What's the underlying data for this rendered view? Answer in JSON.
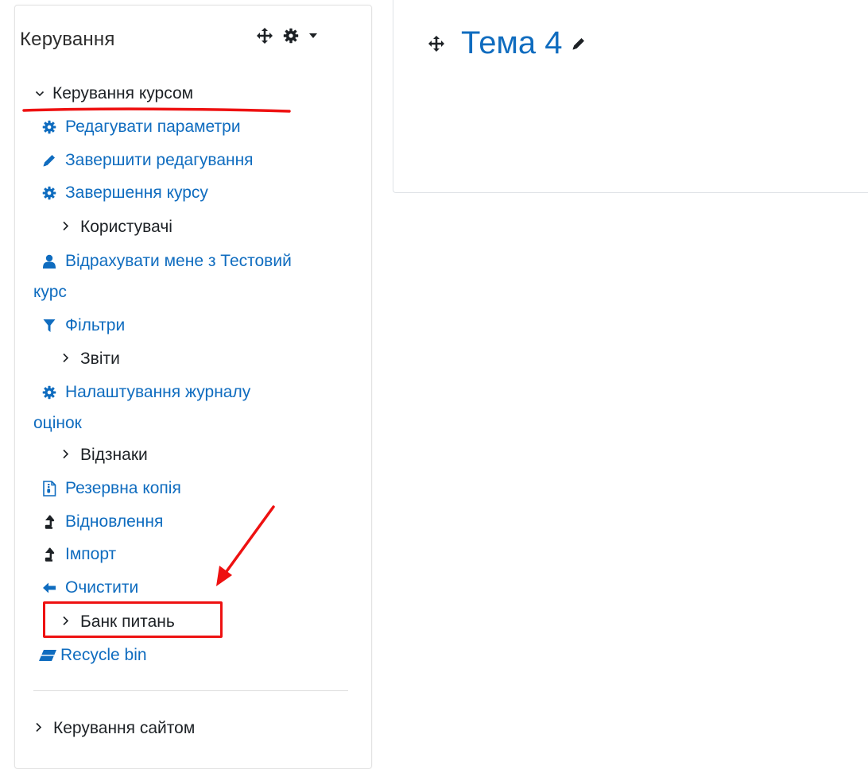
{
  "block": {
    "title": "Керування",
    "course_admin": {
      "label": "Керування курсом",
      "items": [
        {
          "id": "edit-settings",
          "label": "Редагувати параметри",
          "icon": "gear-icon",
          "kind": "link"
        },
        {
          "id": "turn-editing-off",
          "label": "Завершити редагування",
          "icon": "pencil-icon",
          "kind": "link"
        },
        {
          "id": "course-completion",
          "label": "Завершення курсу",
          "icon": "gear-icon",
          "kind": "link"
        },
        {
          "id": "users",
          "label": "Користувачі",
          "icon": "chevron-right-icon",
          "kind": "branch"
        },
        {
          "id": "unenrol",
          "label": "Відрахувати мене з Тестовий",
          "label2": "курс",
          "icon": "user-icon",
          "kind": "link"
        },
        {
          "id": "filters",
          "label": "Фільтри",
          "icon": "filter-icon",
          "kind": "link"
        },
        {
          "id": "reports",
          "label": "Звіти",
          "icon": "chevron-right-icon",
          "kind": "branch"
        },
        {
          "id": "gradebook-setup",
          "label": "Налаштування журналу",
          "label2": "оцінок",
          "icon": "gear-icon",
          "kind": "link"
        },
        {
          "id": "badges",
          "label": "Відзнаки",
          "icon": "chevron-right-icon",
          "kind": "branch"
        },
        {
          "id": "backup",
          "label": "Резервна копія",
          "icon": "backup-file-icon",
          "kind": "link"
        },
        {
          "id": "restore",
          "label": "Відновлення",
          "icon": "upload-arrow-icon",
          "kind": "link"
        },
        {
          "id": "import",
          "label": "Імпорт",
          "icon": "upload-arrow-icon",
          "kind": "link"
        },
        {
          "id": "reset",
          "label": "Очистити",
          "icon": "arrow-left-icon",
          "kind": "link"
        },
        {
          "id": "question-bank",
          "label": "Банк питань",
          "icon": "chevron-right-icon",
          "kind": "branch"
        },
        {
          "id": "recycle-bin",
          "label": "Recycle bin",
          "icon": "eraser-icon",
          "kind": "link"
        }
      ]
    },
    "site_admin": {
      "label": "Керування сайтом"
    }
  },
  "topic": {
    "title": "Тема 4"
  },
  "colors": {
    "link": "#0f6cbf",
    "text": "#1d2125",
    "annotation": "#ee1111"
  }
}
